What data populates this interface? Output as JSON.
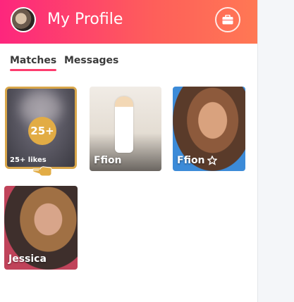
{
  "header": {
    "title": "My Profile",
    "avatar_icon": "user-avatar",
    "work_icon": "briefcase-icon"
  },
  "tabs": [
    {
      "label": "Matches",
      "active": true
    },
    {
      "label": "Messages",
      "active": false
    }
  ],
  "likes_card": {
    "badge": "25+",
    "label": "25+ likes",
    "icon": "hand-pointer-icon"
  },
  "matches": [
    {
      "name": "Ffion",
      "verified": false
    },
    {
      "name": "Ffion",
      "verified": true
    },
    {
      "name": "Jessica",
      "verified": false
    }
  ],
  "colors": {
    "brand_gradient_start": "#fd267d",
    "brand_gradient_end": "#ff7854",
    "gold": "#e2ac45",
    "tab_underline": "#fd3c6e"
  }
}
